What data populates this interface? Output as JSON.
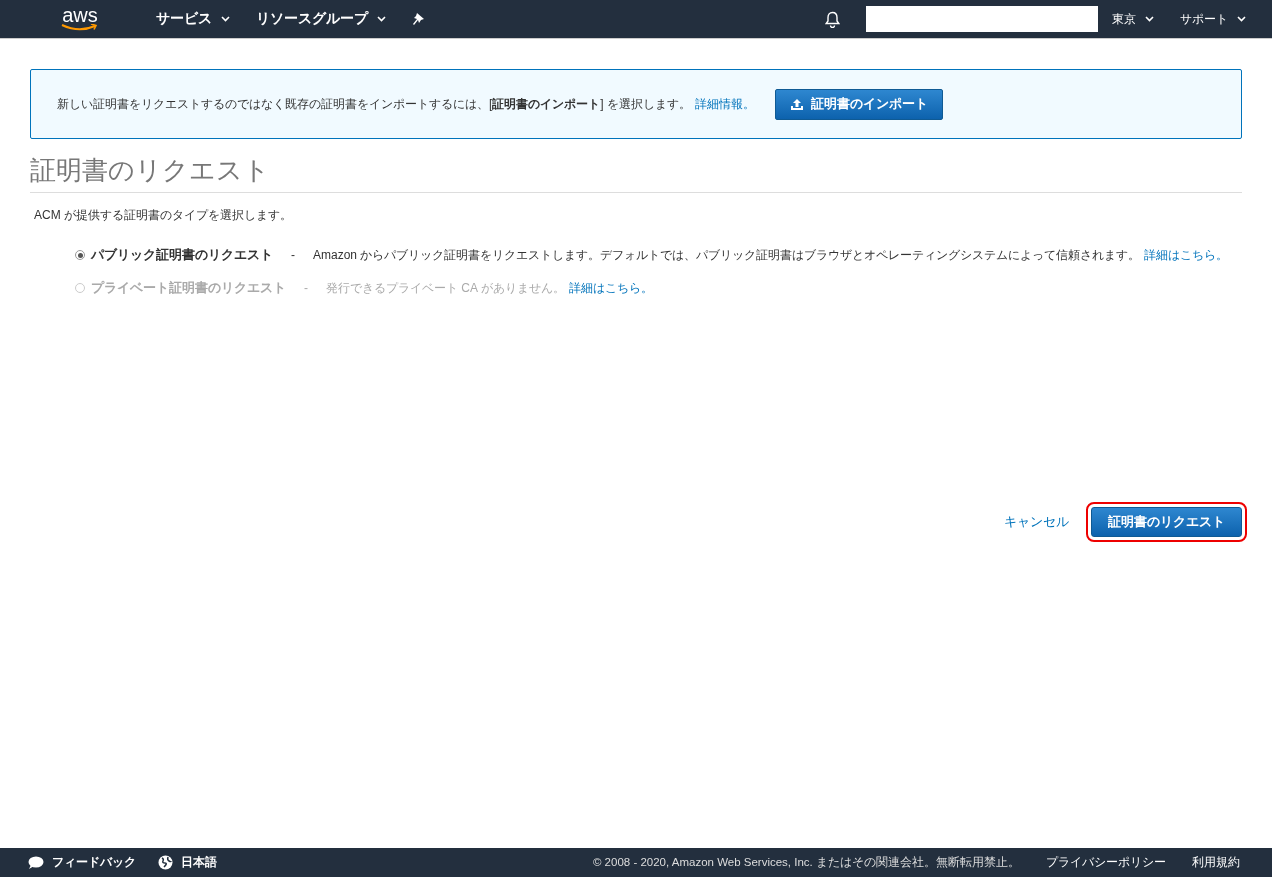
{
  "top_nav": {
    "logo": "aws",
    "menus": [
      {
        "label": "サービス"
      },
      {
        "label": "リソースグループ"
      }
    ],
    "right_menus": [
      {
        "label": "東京"
      },
      {
        "label": "サポート"
      }
    ]
  },
  "info_banner": {
    "text": "新しい証明書をリクエストするのではなく既存の証明書をインポートするには、[**証明書のインポート**] を選択します。",
    "link": "詳細情報。",
    "button": "証明書のインポート"
  },
  "page_title": "証明書のリクエスト",
  "description": "ACM が提供する証明書のタイプを選択します。",
  "options": [
    {
      "label": "パブリック証明書のリクエスト",
      "separator": "-",
      "text": "Amazon からパブリック証明書をリクエストします。デフォルトでは、パブリック証明書はブラウザとオペレーティングシステムによって信頼されます。",
      "link": "詳細はこちら。",
      "selected": true,
      "disabled": false
    },
    {
      "label": "プライベート証明書のリクエスト",
      "separator": "-",
      "text": "発行できるプライベート CA がありません。",
      "link": "詳細はこちら。",
      "selected": false,
      "disabled": true
    }
  ],
  "actions": {
    "cancel": "キャンセル",
    "submit": {
      "label": "証明書のリクエスト",
      "highlighted": true
    }
  },
  "footer": {
    "feedback": "フィードバック",
    "language": "日本語",
    "copyright": "© 2008 - 2020, Amazon Web Services, Inc. またはその関連会社。無断転用禁止。",
    "links": [
      {
        "label": "プライバシーポリシー"
      },
      {
        "label": "利用規約"
      }
    ]
  }
}
